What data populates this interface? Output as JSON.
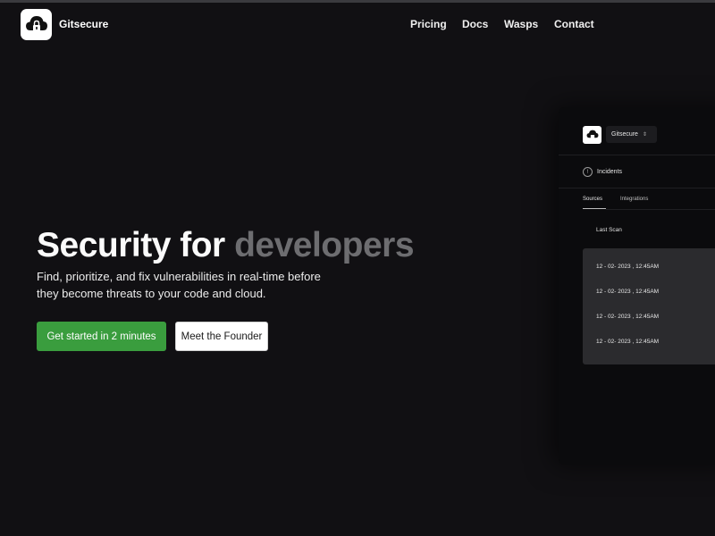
{
  "header": {
    "brand": "Gitsecure",
    "nav": [
      "Pricing",
      "Docs",
      "Wasps",
      "Contact"
    ]
  },
  "hero": {
    "title_main": "Security for",
    "title_faded": "developers",
    "subtitle": "Find, prioritize, and fix vulnerabilities in real-time before they become threats to your code and cloud.",
    "cta_primary": "Get started in 2 minutes",
    "cta_secondary": "Meet the Founder"
  },
  "preview": {
    "workspace": "Gitsecure",
    "incidents_label": "Incidents",
    "tabs": [
      "Sources",
      "Integrations"
    ],
    "column_header": "Last Scan",
    "rows": [
      "12 - 02- 2023 , 12:45AM",
      "12 - 02- 2023 , 12:45AM",
      "12 - 02- 2023 , 12:45AM",
      "12 - 02- 2023 , 12:45AM"
    ]
  },
  "colors": {
    "background": "#111013",
    "primary_button": "#3a9d3e",
    "faded_text": "#6d6d70"
  },
  "icons": {
    "logo": "cloud-lock-icon",
    "select": "chevron-updown-icon",
    "incidents": "alert-circle-icon"
  }
}
